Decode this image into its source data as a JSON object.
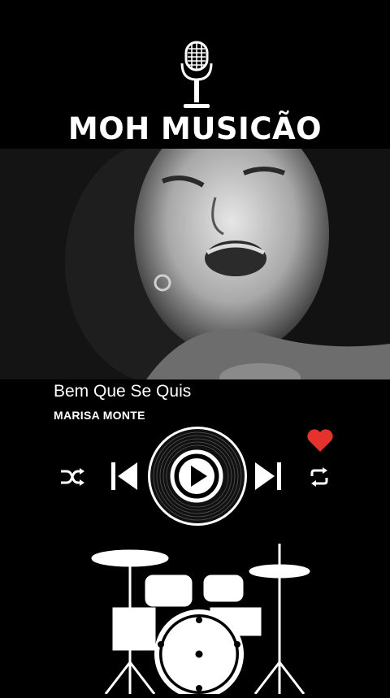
{
  "header": {
    "brand": "MOH MUSICÃO",
    "icon": "microphone-icon"
  },
  "video": {
    "content": "black-and-white video still of a singer",
    "icon": "video-frame"
  },
  "now_playing": {
    "title": "Bem Que Se Quis",
    "artist": "MARISA MONTE"
  },
  "controls": {
    "shuffle_icon": "shuffle-icon",
    "previous_icon": "skip-previous-icon",
    "play_icon": "play-icon",
    "next_icon": "skip-next-icon",
    "repeat_icon": "repeat-icon",
    "favorite_icon": "heart-icon"
  },
  "decor": {
    "drums_icon": "drum-kit-icon",
    "vinyl_icon": "vinyl-record-icon"
  },
  "colors": {
    "background": "#000000",
    "text": "#ffffff",
    "heart": "#e5322d"
  }
}
